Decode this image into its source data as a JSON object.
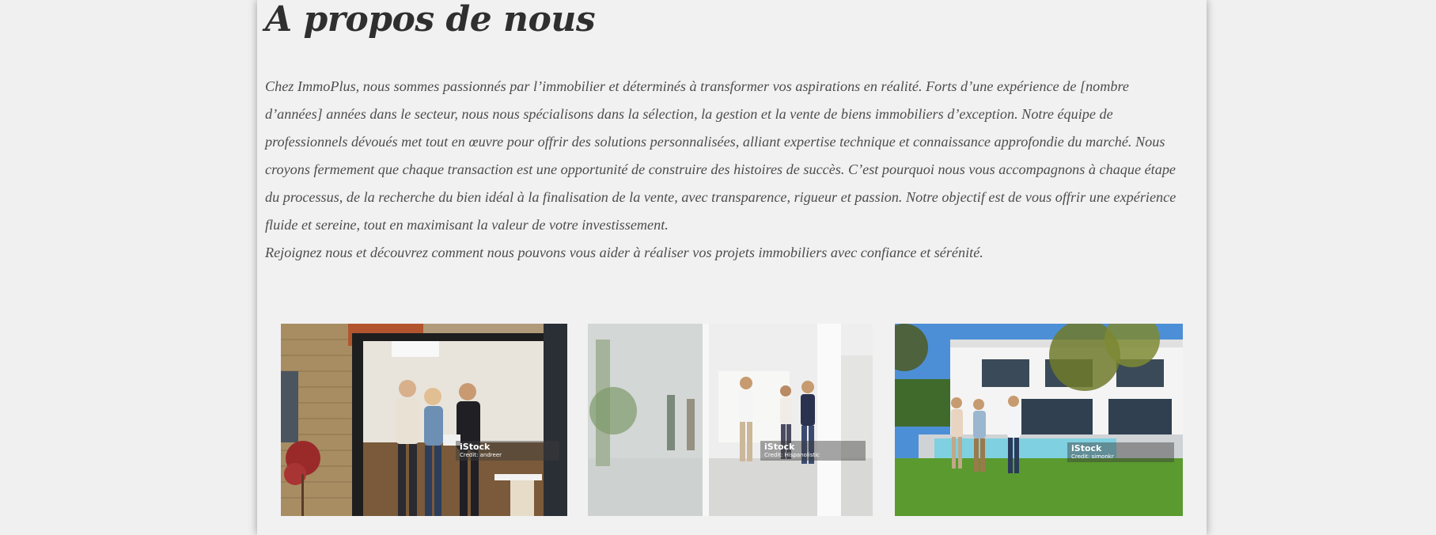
{
  "about": {
    "title": "A propos de nous",
    "paragraph_1": "Chez ImmoPlus, nous sommes passionnés par l’immobilier et déterminés à transformer vos aspirations en réalité. Forts d’une expérience de [nombre d’années] années dans le secteur, nous nous spécialisons dans la sélection, la gestion et la vente de biens immobiliers d’exception. Notre équipe de professionnels dévoués met tout en œuvre pour offrir des solutions personnalisées, alliant expertise technique et connaissance approfondie du marché. Nous croyons fermement que chaque transaction est une opportunité de construire des histoires de succès. C’est pourquoi nous vous accompagnons à chaque étape du processus, de la recherche du bien idéal à la finalisation de la vente, avec transparence, rigueur et passion. Notre objectif est de vous offrir une expérience fluide et sereine, tout en maximisant la valeur de votre investissement.",
    "paragraph_2": "Rejoignez nous et découvrez comment nous pouvons vous aider à réaliser vos projets immobiliers avec confiance et sérénité."
  },
  "gallery": [
    {
      "brand": "iStock",
      "credit": "Credit: andreer"
    },
    {
      "brand": "iStock",
      "credit": "Credit: Hispanolistic"
    },
    {
      "brand": "iStock",
      "credit": "Credit: simonkr"
    }
  ]
}
